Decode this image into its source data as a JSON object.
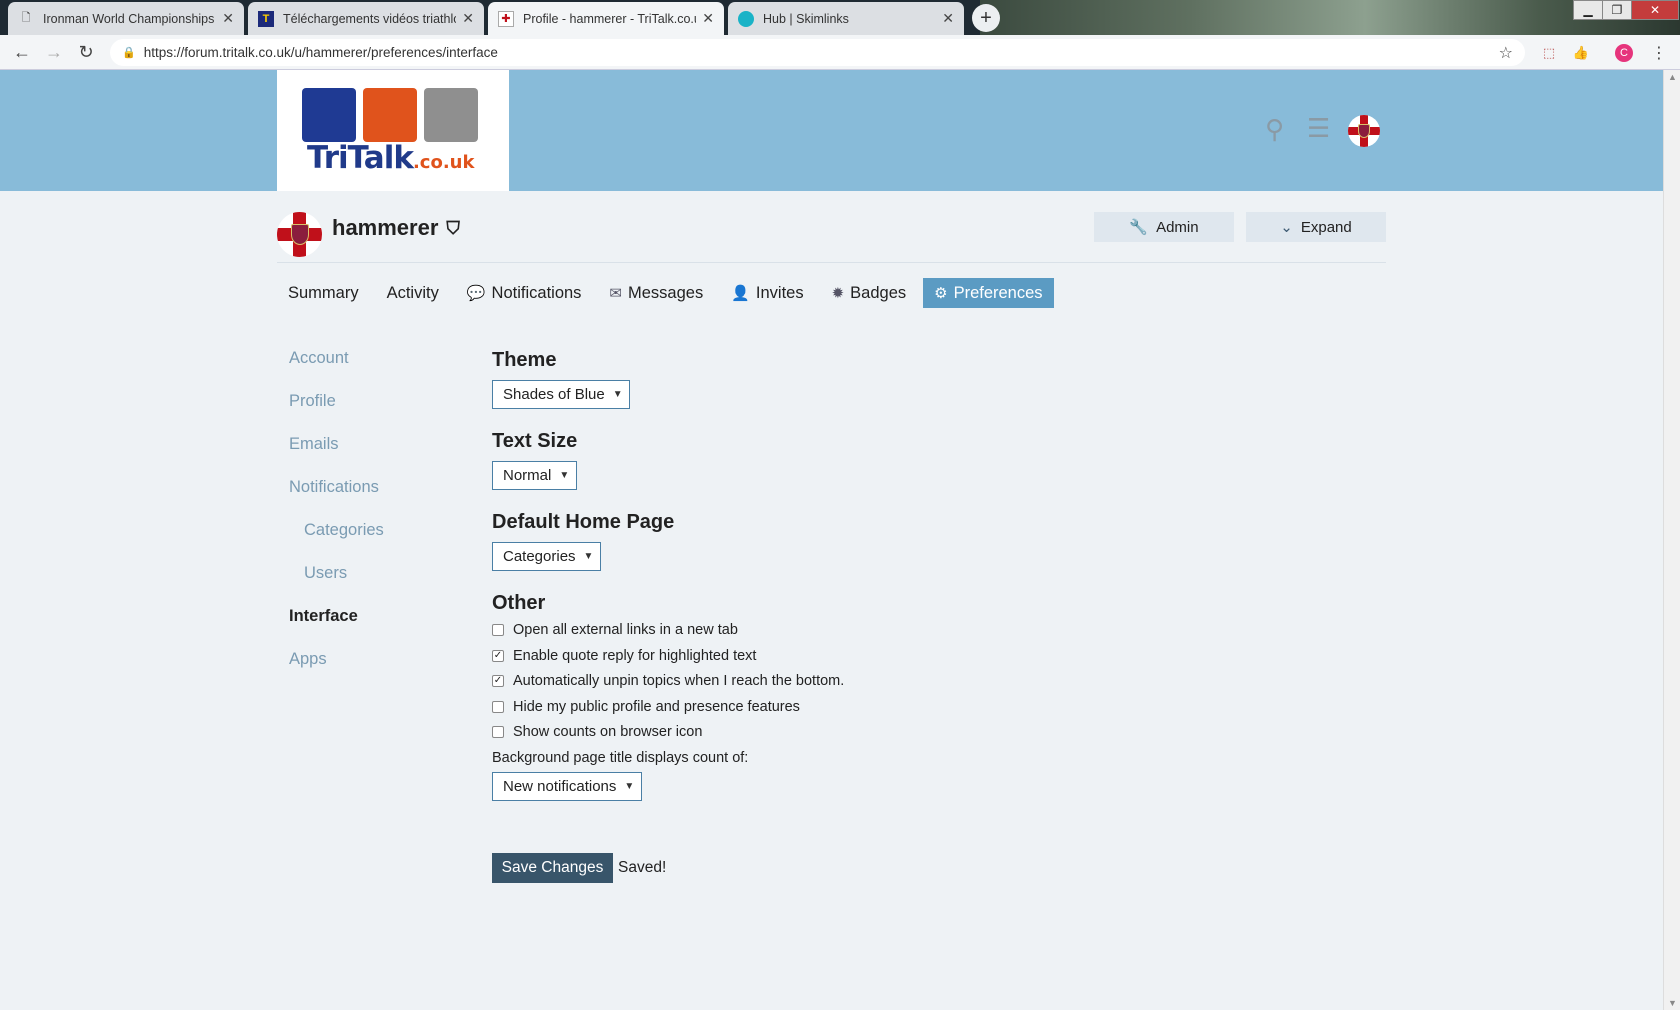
{
  "browser": {
    "tabs": [
      {
        "title": "Ironman World Championships –",
        "icon": "page-icon"
      },
      {
        "title": "Téléchargements vidéos triathlon",
        "icon": "t-favicon"
      },
      {
        "title": "Profile - hammerer - TriTalk.co.uk",
        "icon": "flag-favicon"
      },
      {
        "title": "Hub | Skimlinks",
        "icon": "skimlinks-favicon"
      }
    ],
    "new_tab": "+",
    "url": "https://forum.tritalk.co.uk/u/hammerer/preferences/interface",
    "profile_initial": "C"
  },
  "site": {
    "logo_text": "TriTalk",
    "logo_domain": ".co.uk"
  },
  "user": {
    "name": "hammerer"
  },
  "buttons": {
    "admin": "Admin",
    "expand": "Expand"
  },
  "nav": {
    "tabs": [
      {
        "label": "Summary",
        "icon": ""
      },
      {
        "label": "Activity",
        "icon": ""
      },
      {
        "label": "Notifications",
        "icon": "comment-icon"
      },
      {
        "label": "Messages",
        "icon": "envelope-icon"
      },
      {
        "label": "Invites",
        "icon": "user-plus-icon"
      },
      {
        "label": "Badges",
        "icon": "badge-icon"
      },
      {
        "label": "Preferences",
        "icon": "gear-icon"
      }
    ],
    "active": "Preferences"
  },
  "sidebar": {
    "items": [
      {
        "label": "Account"
      },
      {
        "label": "Profile"
      },
      {
        "label": "Emails"
      },
      {
        "label": "Notifications"
      },
      {
        "label": "Categories"
      },
      {
        "label": "Users"
      },
      {
        "label": "Interface"
      },
      {
        "label": "Apps"
      }
    ],
    "active": "Interface"
  },
  "form": {
    "theme": {
      "title": "Theme",
      "value": "Shades of Blue"
    },
    "text_size": {
      "title": "Text Size",
      "value": "Normal"
    },
    "home_page": {
      "title": "Default Home Page",
      "value": "Categories"
    },
    "other": {
      "title": "Other",
      "options": [
        {
          "label": "Open all external links in a new tab",
          "checked": false
        },
        {
          "label": "Enable quote reply for highlighted text",
          "checked": true
        },
        {
          "label": "Automatically unpin topics when I reach the bottom.",
          "checked": true
        },
        {
          "label": "Hide my public profile and presence features",
          "checked": false
        },
        {
          "label": "Show counts on browser icon",
          "checked": false
        }
      ],
      "bg_title_label": "Background page title displays count of:",
      "bg_title_value": "New notifications"
    },
    "save_label": "Save Changes",
    "status": "Saved!"
  },
  "colors": {
    "header_bg": "#88bbd9",
    "accent": "#5b9bc3",
    "save_button": "#38556a",
    "page_bg": "#eef2f5"
  }
}
